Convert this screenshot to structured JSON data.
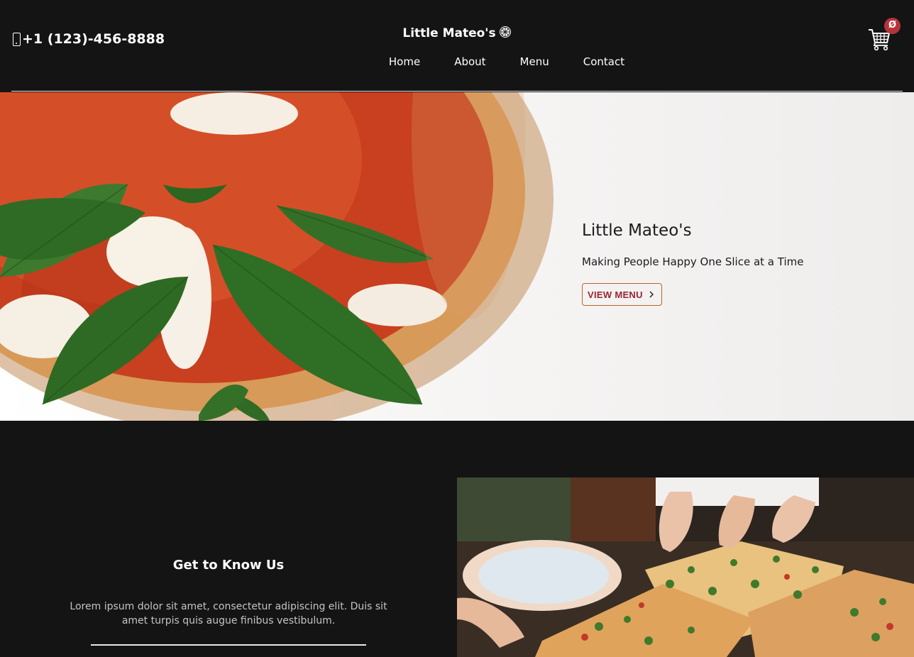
{
  "header": {
    "phone": "+1 (123)-456-8888",
    "brand": "Little Mateo's",
    "cart_count": "Ø",
    "nav": [
      "Home",
      "About",
      "Menu",
      "Contact"
    ]
  },
  "hero": {
    "title": "Little Mateo's",
    "subtitle": "Making People Happy One Slice at a Time",
    "button": "VIEW MENU"
  },
  "about": {
    "title": "Get to Know Us",
    "text": "Lorem ipsum dolor sit amet, consectetur adipiscing elit. Duis sit amet turpis quis augue finibus vestibulum."
  },
  "colors": {
    "background": "#141414",
    "accent": "#b5343c",
    "button_border": "#b8642c"
  },
  "icons": [
    "phone-icon",
    "pizza-icon",
    "cart-icon",
    "chevron-right-icon"
  ]
}
